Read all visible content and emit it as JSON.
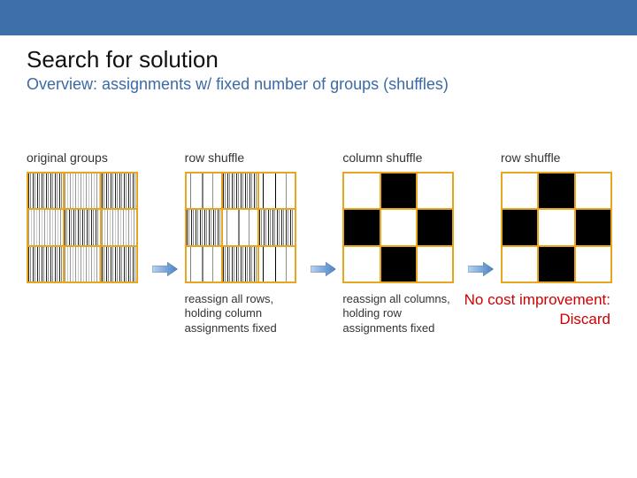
{
  "header": {
    "title": "Search for solution",
    "subtitle": "Overview: assignments w/ fixed number of groups (shuffles)"
  },
  "panels": [
    {
      "label": "original groups",
      "caption": ""
    },
    {
      "label": "row shuffle",
      "caption": "reassign all rows, holding column assignments fixed"
    },
    {
      "label": "column shuffle",
      "caption": "reassign all columns, holding row assignments fixed"
    },
    {
      "label": "row shuffle",
      "caption": ""
    }
  ],
  "result": {
    "line1": "No cost improvement:",
    "line2": "Discard"
  },
  "icons": {
    "arrow": "arrow-right-icon"
  },
  "colors": {
    "topbar": "#3e6fa9",
    "subtitle": "#3b6aa5",
    "matrix_frame": "#e8a61f",
    "result": "#cc0000"
  }
}
